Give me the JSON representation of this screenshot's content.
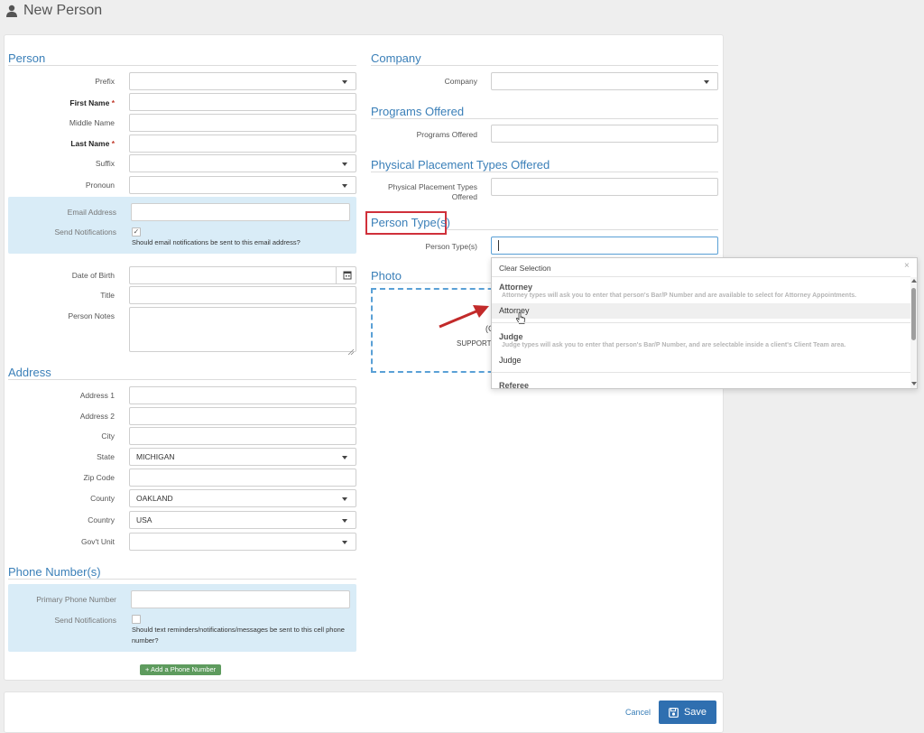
{
  "page": {
    "title": "New Person"
  },
  "person": {
    "section_title": "Person",
    "prefix_label": "Prefix",
    "first_name_label": "First Name",
    "middle_name_label": "Middle Name",
    "last_name_label": "Last Name",
    "required_mark": "*",
    "suffix_label": "Suffix",
    "pronoun_label": "Pronoun",
    "email_label": "Email Address",
    "email_value": "",
    "send_notifications_label": "Send Notifications",
    "send_notifications_checked": true,
    "email_hint": "Should email notifications be sent to this email address?",
    "dob_label": "Date of Birth",
    "title_label": "Title",
    "notes_label": "Person Notes"
  },
  "address": {
    "section_title": "Address",
    "address1_label": "Address 1",
    "address2_label": "Address 2",
    "city_label": "City",
    "state_label": "State",
    "state_value": "MICHIGAN",
    "zip_label": "Zip Code",
    "county_label": "County",
    "county_value": "OAKLAND",
    "country_label": "Country",
    "country_value": "USA",
    "govt_unit_label": "Gov't Unit"
  },
  "phone": {
    "section_title": "Phone Number(s)",
    "primary_label": "Primary Phone Number",
    "send_notifications_label": "Send Notifications",
    "send_notifications_checked": false,
    "hint_line1": "Should text reminders/notifications/messages be sent to this cell phone",
    "hint_line2": "number?",
    "add_button": "+ Add a Phone Number"
  },
  "company": {
    "section_title": "Company",
    "company_label": "Company",
    "programs_title": "Programs Offered",
    "programs_label": "Programs Offered",
    "placement_title": "Physical Placement Types Offered",
    "placement_label_line1": "Physical Placement Types",
    "placement_label_line2": "Offered",
    "person_type_title": "Person Type(s)",
    "person_type_label": "Person Type(s)",
    "photo_title": "Photo",
    "upload_fragment_1": "(C",
    "upload_fragment_2": "SUPPORTE"
  },
  "dropdown": {
    "clear_selection": "Clear Selection",
    "close_glyph": "×",
    "groups": [
      {
        "name": "Attorney",
        "description": "Attorney types will ask you to enter that person's Bar/P Number and are available to select for Attorney Appointments.",
        "options": [
          "Attorney"
        ]
      },
      {
        "name": "Judge",
        "description": "Judge types will ask you to enter that person's Bar/P Number, and are selectable inside a client's Client Team area.",
        "options": [
          "Judge"
        ]
      },
      {
        "name": "Referee",
        "description": "",
        "options": []
      }
    ]
  },
  "footer": {
    "cancel_label": "Cancel",
    "save_label": "Save"
  },
  "colors": {
    "accent": "#3a7fb8",
    "highlight": "#d0303a",
    "save": "#2f6fb0",
    "add": "#5e9b5e"
  }
}
